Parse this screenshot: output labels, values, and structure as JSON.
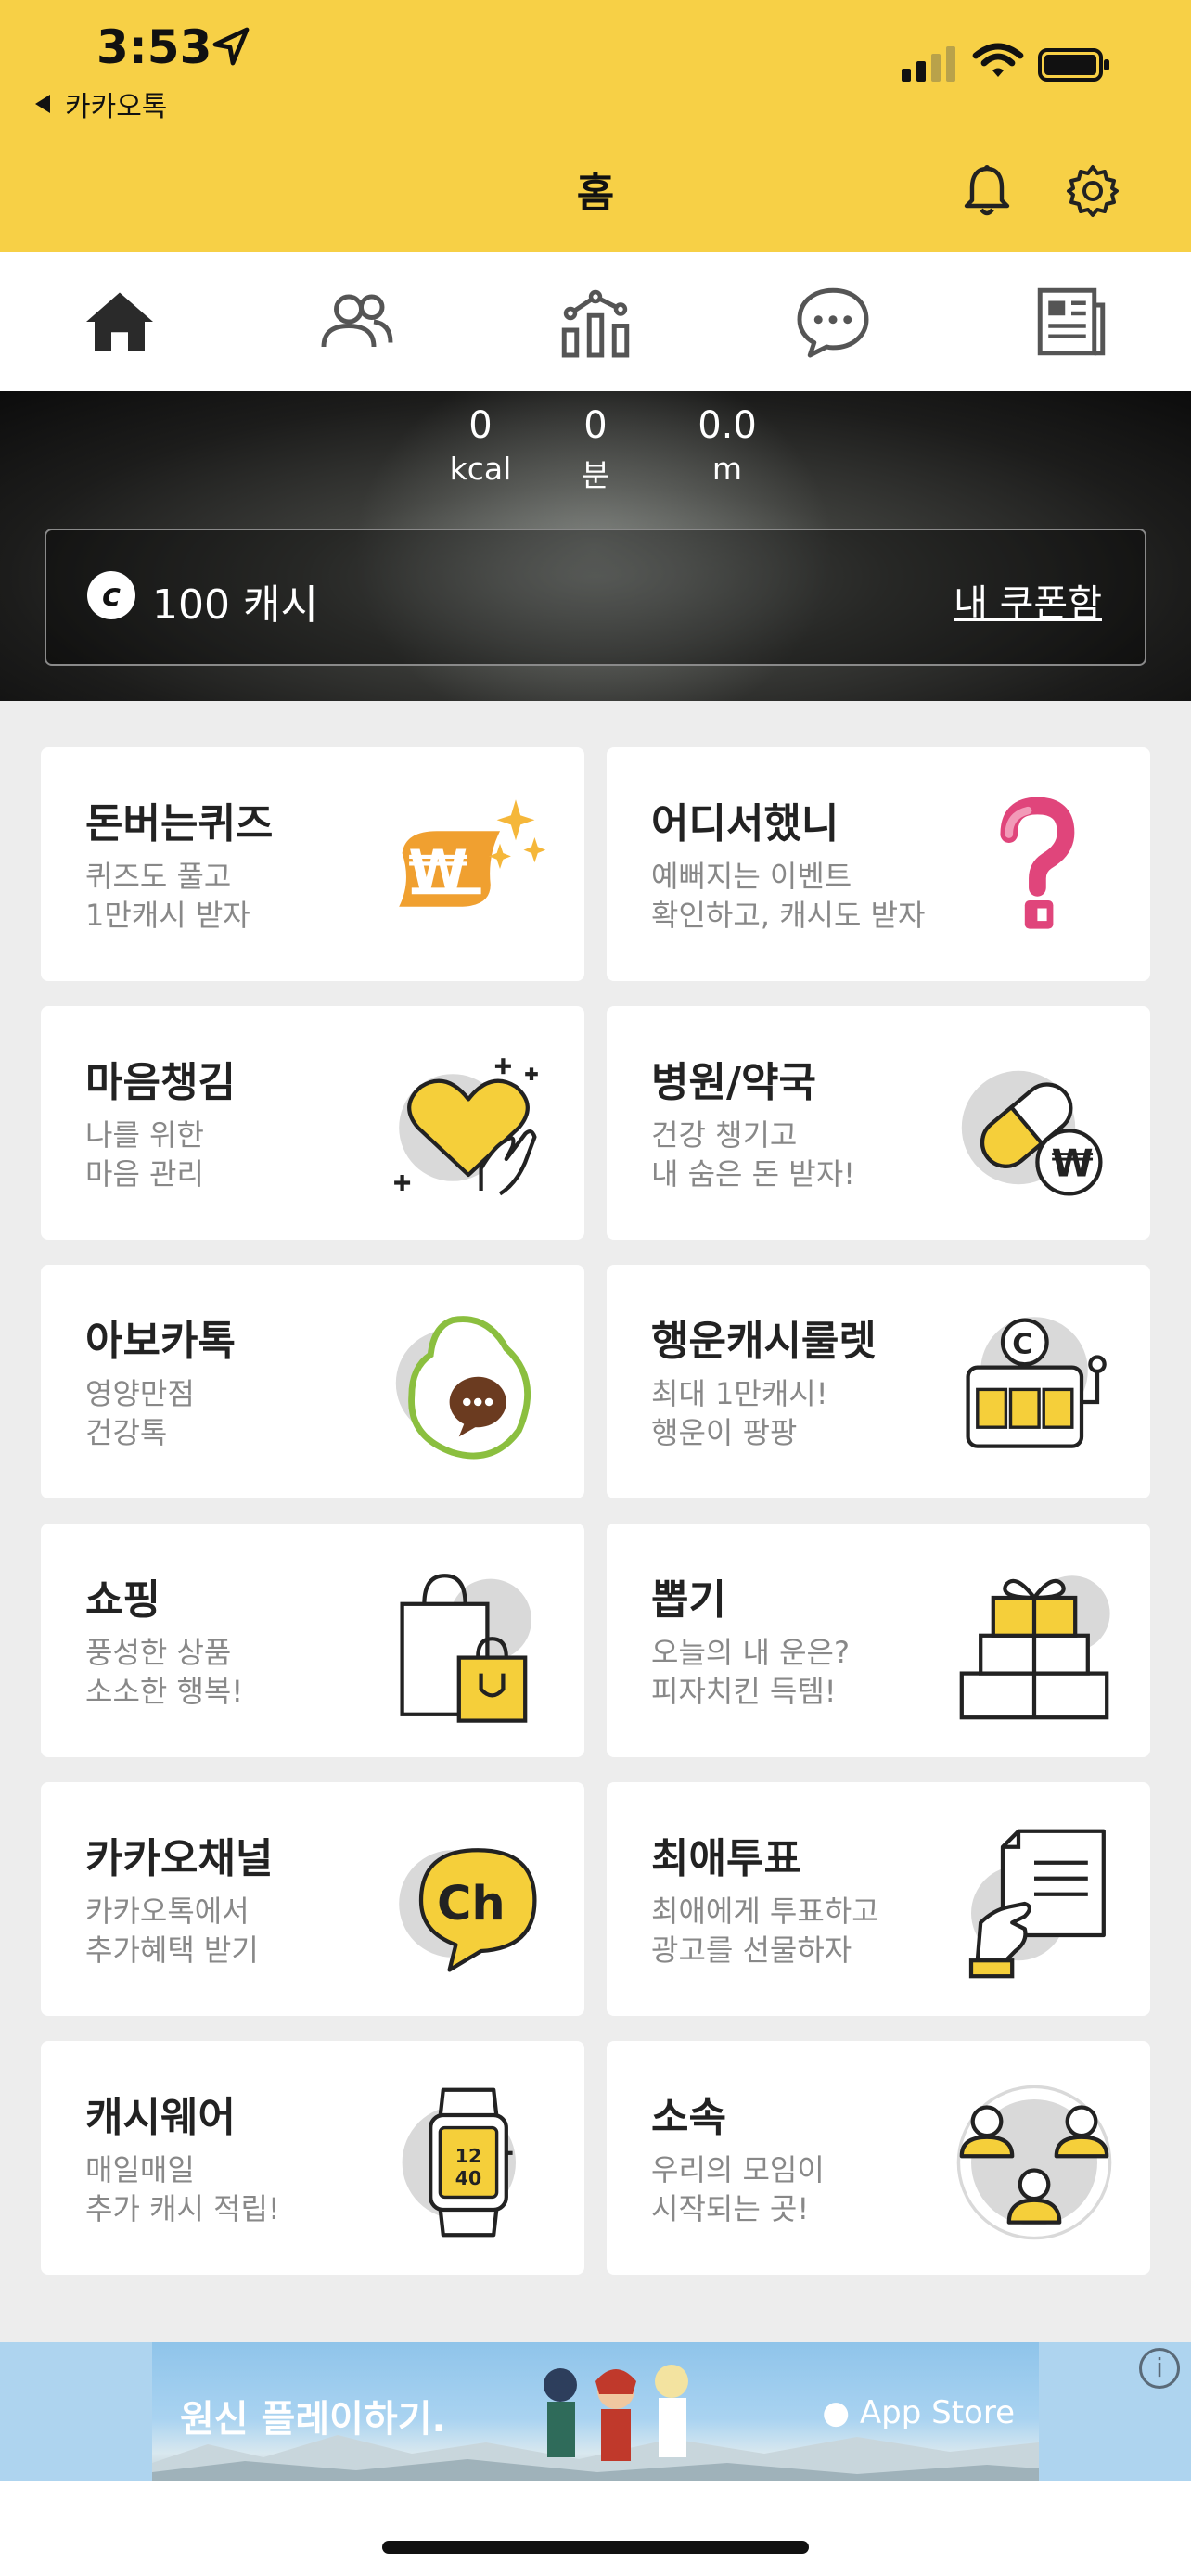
{
  "status_bar": {
    "time": "3:53",
    "back_app": "카카오톡"
  },
  "header": {
    "title": "홈"
  },
  "tabs": [
    {
      "icon": "home-icon"
    },
    {
      "icon": "friends-icon"
    },
    {
      "icon": "stats-icon"
    },
    {
      "icon": "chat-icon"
    },
    {
      "icon": "news-icon"
    }
  ],
  "stats": [
    {
      "value": "0",
      "unit": "kcal"
    },
    {
      "value": "0",
      "unit": "분"
    },
    {
      "value": "0.0",
      "unit": "m"
    }
  ],
  "cash": {
    "symbol": "c",
    "label": "100 캐시",
    "coupon_link": "내 쿠폰함"
  },
  "cards": [
    {
      "title": "돈버는퀴즈",
      "line1": "퀴즈도 풀고",
      "line2": "1만캐시 받자",
      "icon": "won-sparkle-icon"
    },
    {
      "title": "어디서했니",
      "line1": "예뻐지는 이벤트",
      "line2": "확인하고, 캐시도 받자",
      "icon": "question-mark-icon"
    },
    {
      "title": "마음챙김",
      "line1": "나를 위한",
      "line2": "마음 관리",
      "icon": "heart-hand-icon"
    },
    {
      "title": "병원/약국",
      "line1": "건강 챙기고",
      "line2": "내 숨은 돈 받자!",
      "icon": "pill-coin-icon"
    },
    {
      "title": "아보카톡",
      "line1": "영양만점",
      "line2": "건강톡",
      "icon": "avocado-icon"
    },
    {
      "title": "행운캐시룰렛",
      "line1": "최대 1만캐시!",
      "line2": "행운이 팡팡",
      "icon": "slot-machine-icon"
    },
    {
      "title": "쇼핑",
      "line1": "풍성한 상품",
      "line2": "소소한 행복!",
      "icon": "shopping-bag-icon"
    },
    {
      "title": "뽑기",
      "line1": "오늘의 내 운은?",
      "line2": "피자치킨 득템!",
      "icon": "gift-box-icon"
    },
    {
      "title": "카카오채널",
      "line1": "카카오톡에서",
      "line2": "추가혜택 받기",
      "icon": "channel-bubble-icon"
    },
    {
      "title": "최애투표",
      "line1": "최애에게 투표하고",
      "line2": "광고를 선물하자",
      "icon": "vote-paper-icon"
    },
    {
      "title": "캐시웨어",
      "line1": "매일매일",
      "line2": "추가 캐시 적립!",
      "icon": "watch-icon",
      "watch_top": "12",
      "watch_bottom": "40"
    },
    {
      "title": "소속",
      "line1": "우리의 모임이",
      "line2": "시작되는 곳!",
      "icon": "group-icon"
    }
  ],
  "ad": {
    "text": "원신 플레이하기.",
    "store": " App Store",
    "info": "i"
  },
  "colors": {
    "brand_yellow": "#f7d046",
    "accent_yellow": "#f5cf3a",
    "orange": "#f0a030",
    "pink": "#e0457b",
    "green": "#8bbf3f"
  }
}
